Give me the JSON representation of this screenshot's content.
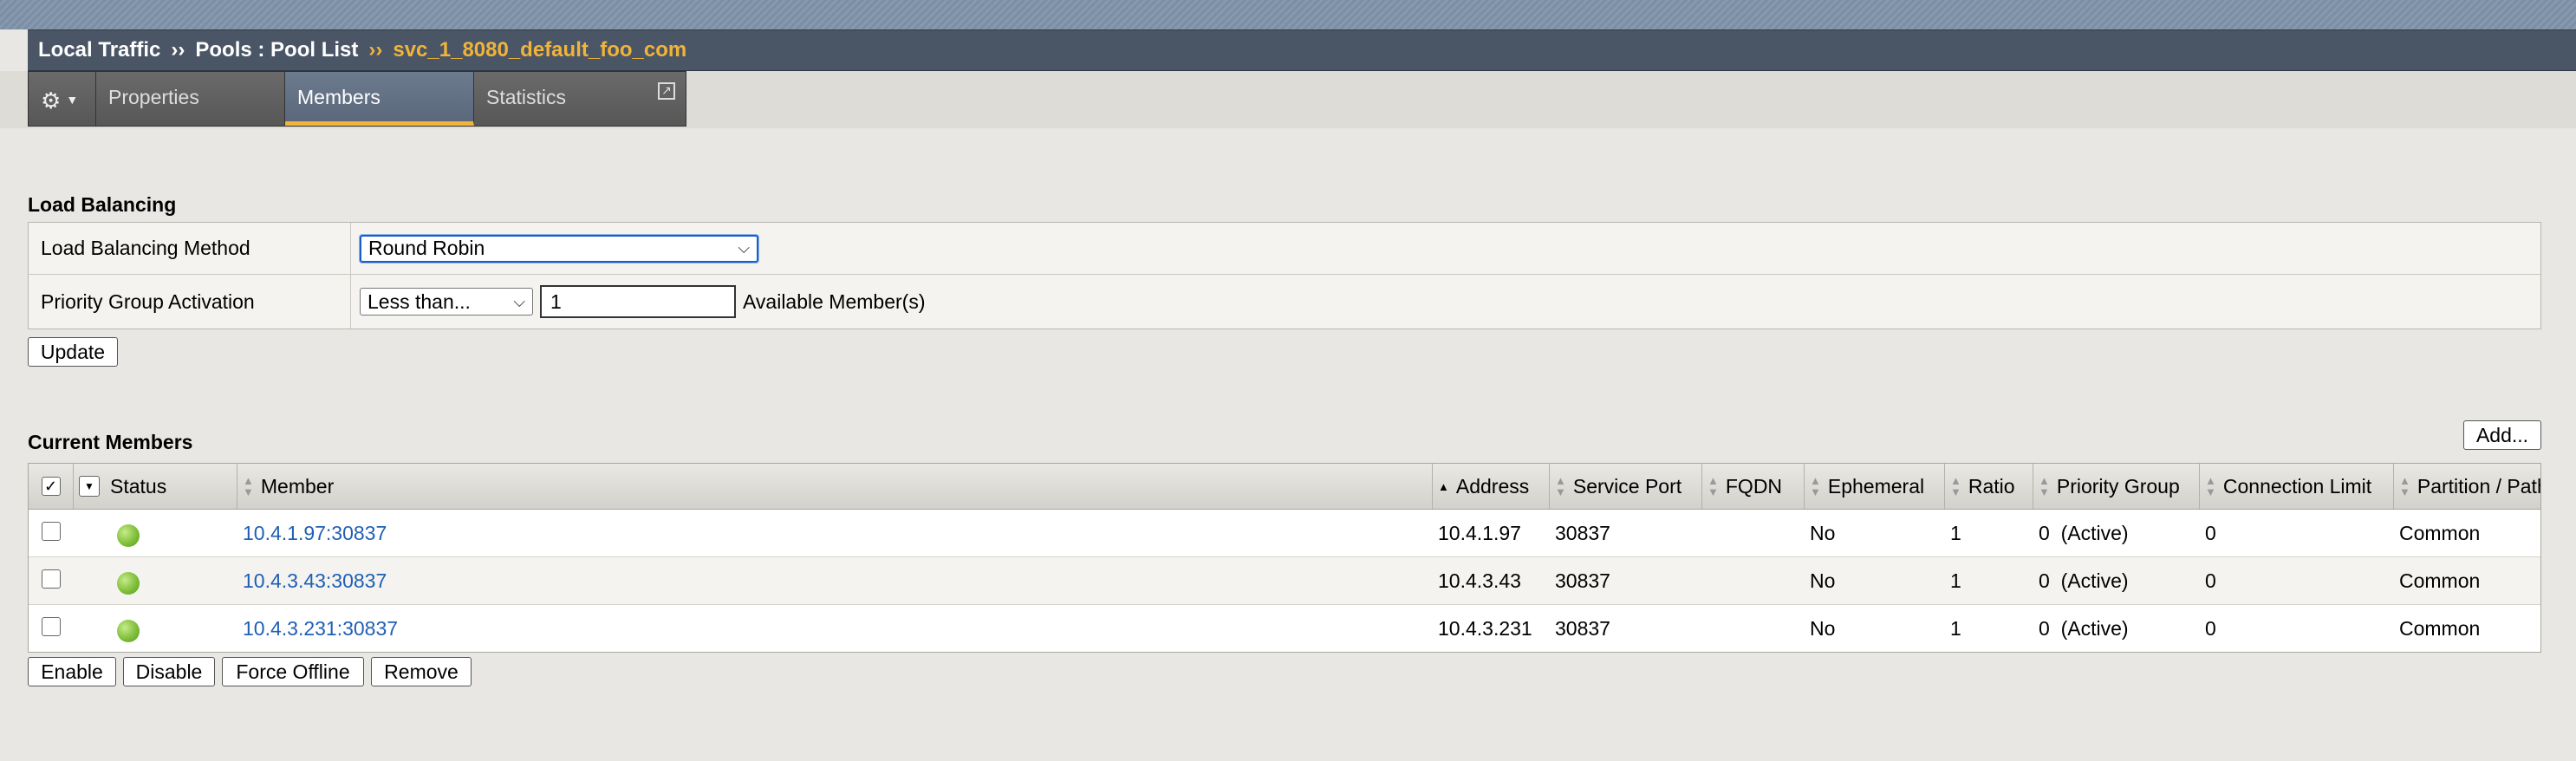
{
  "breadcrumb": {
    "part1": "Local Traffic",
    "sep1": "››",
    "part2": "Pools : Pool List",
    "sep2": "››",
    "current": "svc_1_8080_default_foo_com"
  },
  "tabs": {
    "gear_icon": "gear-icon",
    "properties": "Properties",
    "members": "Members",
    "statistics": "Statistics"
  },
  "load_balancing": {
    "title": "Load Balancing",
    "method_label": "Load Balancing Method",
    "method_value": "Round Robin",
    "priority_label": "Priority Group Activation",
    "priority_select": "Less than...",
    "priority_value": "1",
    "priority_suffix": "Available Member(s)",
    "update_button": "Update"
  },
  "members": {
    "title": "Current Members",
    "add_button": "Add...",
    "columns": [
      "Status",
      "Member",
      "Address",
      "Service Port",
      "FQDN",
      "Ephemeral",
      "Ratio",
      "Priority Group",
      "Connection Limit",
      "Partition / Path"
    ],
    "rows": [
      {
        "member": "10.4.1.97:30837",
        "address": "10.4.1.97",
        "port": "30837",
        "fqdn": "",
        "ephemeral": "No",
        "ratio": "1",
        "priority": "0  (Active)",
        "conn_limit": "0",
        "partition": "Common",
        "status": "available"
      },
      {
        "member": "10.4.3.43:30837",
        "address": "10.4.3.43",
        "port": "30837",
        "fqdn": "",
        "ephemeral": "No",
        "ratio": "1",
        "priority": "0  (Active)",
        "conn_limit": "0",
        "partition": "Common",
        "status": "available"
      },
      {
        "member": "10.4.3.231:30837",
        "address": "10.4.3.231",
        "port": "30837",
        "fqdn": "",
        "ephemeral": "No",
        "ratio": "1",
        "priority": "0  (Active)",
        "conn_limit": "0",
        "partition": "Common",
        "status": "available"
      }
    ],
    "actions": {
      "enable": "Enable",
      "disable": "Disable",
      "force_offline": "Force Offline",
      "remove": "Remove"
    }
  },
  "colors": {
    "title_bar": "#4a5566",
    "accent": "#f0b43a",
    "link": "#1f5fb5",
    "status_green": "#7fbf3a"
  }
}
